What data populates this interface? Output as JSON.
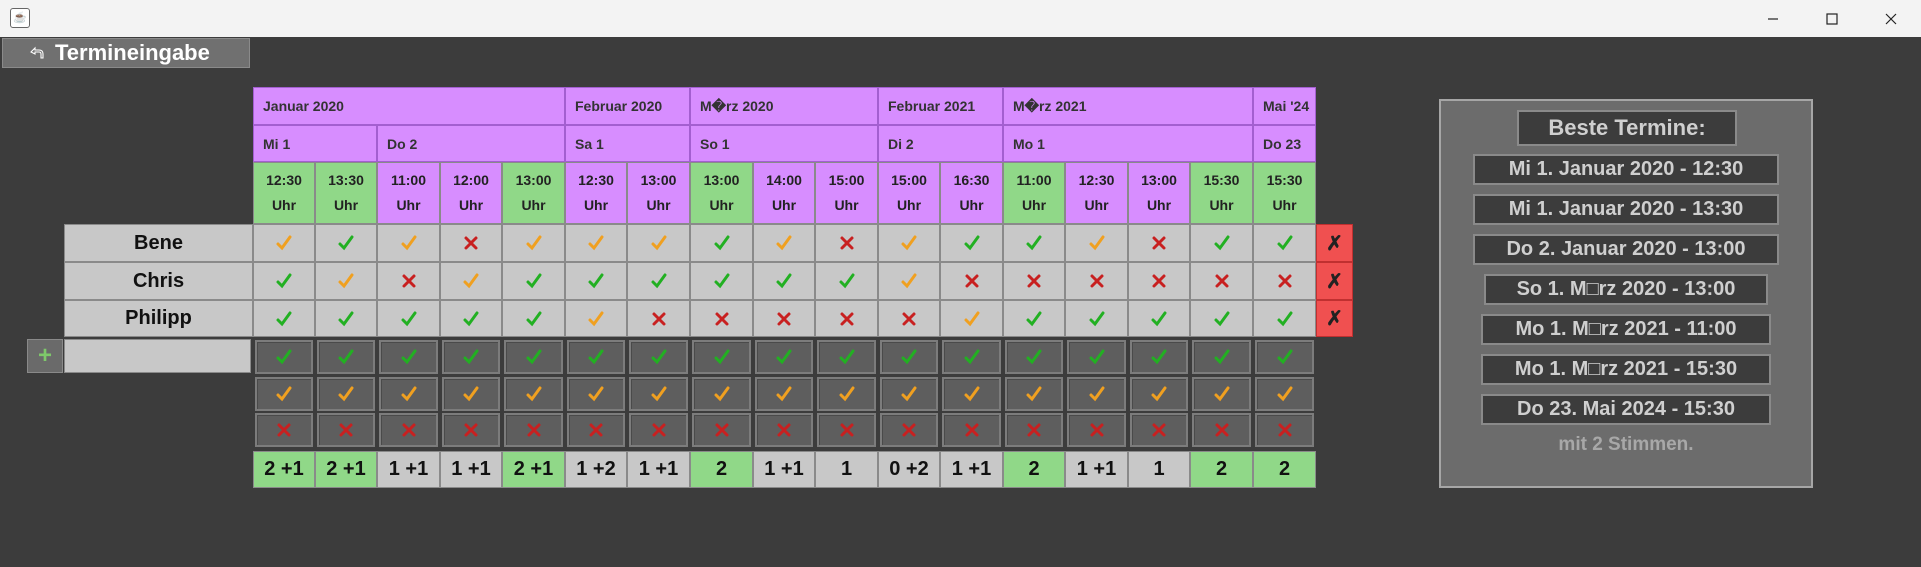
{
  "window": {
    "title": ""
  },
  "toolbar": {
    "back_label": "Termineingabe"
  },
  "months": [
    {
      "label": "Januar 2020"
    },
    {
      "label": "Februar 2020"
    },
    {
      "label": "M�rz 2020"
    },
    {
      "label": "Februar 2021"
    },
    {
      "label": "M�rz 2021"
    },
    {
      "label": "Mai '24"
    }
  ],
  "days": [
    {
      "label": "Mi 1"
    },
    {
      "label": "Do 2"
    },
    {
      "label": "Sa 1"
    },
    {
      "label": "So 1"
    },
    {
      "label": "Di 2"
    },
    {
      "label": "Mo 1"
    },
    {
      "label": "Do 23"
    }
  ],
  "times": [
    {
      "time": "12:30",
      "unit": "Uhr",
      "best": true
    },
    {
      "time": "13:30",
      "unit": "Uhr",
      "best": true
    },
    {
      "time": "11:00",
      "unit": "Uhr",
      "best": false
    },
    {
      "time": "12:00",
      "unit": "Uhr",
      "best": false
    },
    {
      "time": "13:00",
      "unit": "Uhr",
      "best": true
    },
    {
      "time": "12:30",
      "unit": "Uhr",
      "best": false
    },
    {
      "time": "13:00",
      "unit": "Uhr",
      "best": false
    },
    {
      "time": "13:00",
      "unit": "Uhr",
      "best": true
    },
    {
      "time": "14:00",
      "unit": "Uhr",
      "best": false
    },
    {
      "time": "15:00",
      "unit": "Uhr",
      "best": false
    },
    {
      "time": "15:00",
      "unit": "Uhr",
      "best": false
    },
    {
      "time": "16:30",
      "unit": "Uhr",
      "best": false
    },
    {
      "time": "11:00",
      "unit": "Uhr",
      "best": true
    },
    {
      "time": "12:30",
      "unit": "Uhr",
      "best": false
    },
    {
      "time": "13:00",
      "unit": "Uhr",
      "best": false
    },
    {
      "time": "15:30",
      "unit": "Uhr",
      "best": true
    },
    {
      "time": "15:30",
      "unit": "Uhr",
      "best": true
    }
  ],
  "participants": [
    {
      "name": "Bene",
      "votes": [
        "maybe",
        "yes",
        "maybe",
        "no",
        "maybe",
        "maybe",
        "maybe",
        "yes",
        "maybe",
        "no",
        "maybe",
        "yes",
        "yes",
        "maybe",
        "no",
        "yes",
        "yes"
      ],
      "delete_label": "✗"
    },
    {
      "name": "Chris",
      "votes": [
        "yes",
        "maybe",
        "no",
        "maybe",
        "yes",
        "yes",
        "yes",
        "yes",
        "yes",
        "yes",
        "maybe",
        "no",
        "no",
        "no",
        "no",
        "no",
        "no"
      ],
      "delete_label": "✗"
    },
    {
      "name": "Philipp",
      "votes": [
        "yes",
        "yes",
        "yes",
        "yes",
        "yes",
        "maybe",
        "no",
        "no",
        "no",
        "no",
        "no",
        "maybe",
        "yes",
        "yes",
        "yes",
        "yes",
        "yes"
      ],
      "delete_label": "✗"
    }
  ],
  "new_participant": {
    "add_label": "+",
    "name_value": ""
  },
  "totals": [
    {
      "label": "2 +1",
      "best": true
    },
    {
      "label": "2 +1",
      "best": true
    },
    {
      "label": "1 +1",
      "best": false
    },
    {
      "label": "1 +1",
      "best": false
    },
    {
      "label": "2 +1",
      "best": true
    },
    {
      "label": "1 +2",
      "best": false
    },
    {
      "label": "1 +1",
      "best": false
    },
    {
      "label": "2",
      "best": true
    },
    {
      "label": "1 +1",
      "best": false
    },
    {
      "label": "1",
      "best": false
    },
    {
      "label": "0 +2",
      "best": false
    },
    {
      "label": "1 +1",
      "best": false
    },
    {
      "label": "2",
      "best": true
    },
    {
      "label": "1 +1",
      "best": false
    },
    {
      "label": "1",
      "best": false
    },
    {
      "label": "2",
      "best": true
    },
    {
      "label": "2",
      "best": true
    }
  ],
  "best_panel": {
    "title": "Beste Termine:",
    "items": [
      "Mi 1. Januar 2020 - 12:30",
      "Mi 1. Januar 2020 - 13:30",
      "Do 2. Januar 2020 - 13:00",
      "So 1. M□rz 2020 - 13:00",
      "Mo 1. M□rz 2021 - 11:00",
      "Mo 1. M□rz 2021 - 15:30",
      "Do 23. Mai 2024 - 15:30"
    ],
    "footer": "mit 2 Stimmen."
  },
  "colors": {
    "yes": "#22b022",
    "maybe": "#f0a020",
    "no": "#c82020",
    "best": "#90d888",
    "header": "#d78dff",
    "delete": "#f05050"
  }
}
